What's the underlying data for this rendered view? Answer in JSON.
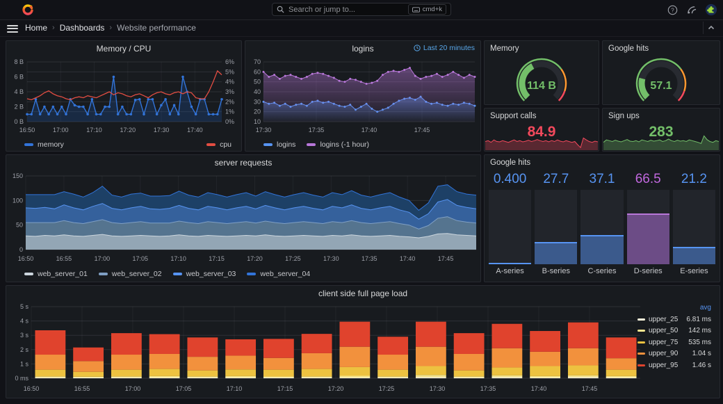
{
  "colors": {
    "page_bg": "#111217",
    "panel_bg": "#181b1f",
    "blue": "#5794F2",
    "dark_blue": "#3274D9",
    "purple": "#B877D9",
    "green": "#73BF69",
    "red": "#F2495C",
    "orange": "#FF9830",
    "time_badge": "#58a6e8",
    "axis_text": "#9da0a8"
  },
  "nav": {
    "search_placeholder": "Search or jump to...",
    "search_shortcut": "cmd+k",
    "icons": [
      "help-icon",
      "news-icon",
      "user-avatar"
    ],
    "breadcrumb": {
      "home": "Home",
      "dashboards": "Dashboards",
      "current": "Website performance"
    }
  },
  "stats": {
    "memory_gauge": {
      "title": "Memory",
      "value": "114 B",
      "percent": 0.4,
      "color": "#73BF69",
      "thresholds": [
        {
          "upto": 0.7,
          "color": "#73BF69"
        },
        {
          "upto": 0.9,
          "color": "#FF9830"
        },
        {
          "upto": 1.0,
          "color": "#F2495C"
        }
      ]
    },
    "google_gauge": {
      "title": "Google hits",
      "value": "57.1",
      "percent": 0.22,
      "color": "#73BF69",
      "thresholds": [
        {
          "upto": 0.7,
          "color": "#73BF69"
        },
        {
          "upto": 0.9,
          "color": "#FF9830"
        },
        {
          "upto": 1.0,
          "color": "#F2495C"
        }
      ]
    },
    "support_calls": {
      "title": "Support calls",
      "value": "84.9",
      "color": "#F2495C",
      "fill": "rgba(242,73,92,0.30)",
      "spark": [
        0.5,
        0.55,
        0.45,
        0.6,
        0.5,
        0.48,
        0.55,
        0.5,
        0.45,
        0.52,
        0.6,
        0.5,
        0.55,
        0.48,
        0.52,
        0.58,
        0.5,
        0.55,
        0.62,
        0.55,
        0.5,
        0.55,
        0.48,
        0.56,
        0.5,
        0.6,
        0.52,
        0.48,
        0.55,
        0.5,
        0.45,
        0.5,
        0.3,
        0.12,
        0.72,
        0.6,
        0.5,
        0.45,
        0.52,
        0.48
      ]
    },
    "sign_ups": {
      "title": "Sign ups",
      "value": "283",
      "color": "#73BF69",
      "fill": "rgba(115,191,105,0.30)",
      "spark": [
        0.45,
        0.6,
        0.55,
        0.5,
        0.58,
        0.52,
        0.48,
        0.55,
        0.62,
        0.52,
        0.5,
        0.55,
        0.48,
        0.6,
        0.55,
        0.5,
        0.58,
        0.52,
        0.55,
        0.6,
        0.5,
        0.55,
        0.65,
        0.55,
        0.5,
        0.58,
        0.52,
        0.55,
        0.5,
        0.6,
        0.55,
        0.5,
        0.45,
        0.38,
        0.85,
        0.62,
        0.5,
        0.45,
        0.55,
        0.5
      ]
    }
  },
  "chart_data": [
    {
      "id": "memory_cpu",
      "type": "line",
      "title": "Memory / CPU",
      "x_ticks": [
        "16:50",
        "17:00",
        "17:10",
        "17:20",
        "17:30",
        "17:40"
      ],
      "x_span_min": 58,
      "x_tick_step_min": 10,
      "y_left": {
        "ticks": [
          "0 B",
          "2 B",
          "4 B",
          "6 B",
          "8 B"
        ],
        "max": 8
      },
      "y_right": {
        "ticks": [
          "0%",
          "1%",
          "2%",
          "3%",
          "4%",
          "5%",
          "6%"
        ],
        "max": 6
      },
      "series": [
        {
          "name": "memory",
          "color": "#3274D9",
          "fill": "rgba(31,96,196,0.22)",
          "axis": "left",
          "points": true,
          "values": [
            1,
            1,
            3,
            1,
            2,
            1,
            2,
            1,
            2,
            1,
            3,
            2.2,
            2,
            2,
            1,
            3,
            1,
            1,
            2,
            2,
            6,
            1,
            2,
            1,
            1,
            2.9,
            3,
            1,
            3,
            3,
            1,
            2.2,
            3,
            1,
            2.2,
            1,
            6,
            4,
            2,
            1,
            3,
            3,
            1,
            1,
            1,
            3
          ]
        },
        {
          "name": "cpu",
          "color": "#E24D42",
          "axis": "right",
          "points": false,
          "values": [
            2.3,
            2.2,
            2.4,
            2.6,
            2.9,
            3.1,
            2.8,
            2.6,
            2.5,
            2.3,
            2.2,
            2.4,
            2.5,
            2.4,
            2.6,
            2.5,
            2.4,
            2.6,
            2.8,
            3.0,
            2.7,
            2.9,
            2.8,
            2.6,
            2.5,
            2.7,
            2.8,
            2.6,
            2.4,
            2.7,
            2.9,
            3.0,
            2.8,
            2.7,
            2.9,
            3.0,
            2.8,
            3.0,
            2.9,
            2.4,
            2.3,
            2.3,
            3.0,
            4.0,
            5.1,
            4.7
          ]
        }
      ]
    },
    {
      "id": "logins",
      "type": "line",
      "title": "logins",
      "time_range": "Last 20 minutes",
      "x_ticks": [
        "17:30",
        "17:35",
        "17:40",
        "17:45"
      ],
      "x_span_min": 20,
      "x_tick_step_min": 5,
      "ylim": [
        10,
        70
      ],
      "y_ticks": [
        "10",
        "20",
        "30",
        "40",
        "50",
        "60",
        "70"
      ],
      "series": [
        {
          "name": "logins",
          "color": "#5794F2",
          "values": [
            30,
            28,
            29,
            26,
            28,
            25,
            27,
            28,
            26,
            30,
            31,
            29,
            30,
            28,
            26,
            25,
            27,
            22,
            25,
            28,
            23,
            20,
            22,
            24,
            28,
            31,
            33,
            34,
            32,
            35,
            30,
            28,
            29,
            27,
            26,
            28,
            27,
            29,
            28,
            26
          ]
        },
        {
          "name": "logins (-1 hour)",
          "color": "#B877D9",
          "values": [
            60,
            55,
            57,
            53,
            56,
            57,
            55,
            53,
            55,
            58,
            59,
            58,
            56,
            54,
            51,
            50,
            53,
            52,
            50,
            48,
            49,
            51,
            57,
            60,
            61,
            60,
            62,
            64,
            56,
            53,
            55,
            56,
            58,
            55,
            57,
            60,
            57,
            54,
            57,
            55
          ]
        }
      ]
    },
    {
      "id": "server_requests",
      "type": "area",
      "stacked": true,
      "title": "server requests",
      "x_ticks": [
        "16:50",
        "16:55",
        "17:00",
        "17:05",
        "17:10",
        "17:15",
        "17:20",
        "17:25",
        "17:30",
        "17:35",
        "17:40",
        "17:45"
      ],
      "x_span_min": 59,
      "x_tick_step_min": 5,
      "ylim": [
        0,
        150
      ],
      "y_ticks": [
        "0",
        "50",
        "100",
        "150"
      ],
      "series": [
        {
          "name": "web_server_01",
          "color": "#CCD6DE",
          "fill": "#93a6b5",
          "values": [
            28,
            27,
            29,
            28,
            30,
            28,
            27,
            29,
            31,
            28,
            27,
            28,
            29,
            28,
            27,
            28,
            30,
            28,
            27,
            29,
            28,
            27,
            28,
            29,
            28,
            30,
            28,
            27,
            28,
            29,
            28,
            27,
            29,
            28,
            30,
            28,
            27,
            28,
            29,
            27,
            26,
            24,
            27,
            32,
            33,
            30,
            29,
            28
          ]
        },
        {
          "name": "web_server_02",
          "color": "#7f9fc4",
          "fill": "#55748f",
          "values": [
            27,
            28,
            26,
            27,
            29,
            27,
            26,
            28,
            30,
            27,
            26,
            27,
            28,
            26,
            27,
            26,
            28,
            27,
            26,
            28,
            27,
            26,
            27,
            28,
            26,
            28,
            27,
            26,
            27,
            28,
            27,
            26,
            28,
            27,
            29,
            27,
            26,
            27,
            28,
            26,
            24,
            18,
            22,
            32,
            34,
            29,
            27,
            26
          ]
        },
        {
          "name": "web_server_03",
          "color": "#5794F2",
          "fill": "#35619c",
          "values": [
            30,
            29,
            31,
            28,
            32,
            30,
            28,
            31,
            33,
            29,
            28,
            30,
            31,
            29,
            28,
            30,
            32,
            29,
            28,
            31,
            30,
            28,
            30,
            31,
            29,
            32,
            30,
            28,
            30,
            31,
            29,
            28,
            31,
            30,
            32,
            29,
            28,
            30,
            31,
            28,
            26,
            20,
            24,
            33,
            35,
            31,
            30,
            29
          ]
        },
        {
          "name": "web_server_04",
          "color": "#3274D9",
          "fill": "#1d4066",
          "values": [
            27,
            28,
            26,
            29,
            27,
            28,
            26,
            28,
            35,
            27,
            26,
            28,
            27,
            26,
            27,
            26,
            29,
            27,
            26,
            28,
            27,
            26,
            27,
            28,
            26,
            28,
            27,
            26,
            27,
            28,
            27,
            26,
            28,
            27,
            29,
            27,
            26,
            27,
            28,
            26,
            24,
            18,
            22,
            32,
            30,
            28,
            27,
            28
          ]
        }
      ]
    },
    {
      "id": "google_hits_bars",
      "type": "bar",
      "title": "Google hits",
      "max": 100,
      "bars": [
        {
          "label": "A-series",
          "display": "0.400",
          "value": 0.4,
          "value_color": "#5794F2",
          "fill": "#3B5A8C",
          "top": "#5794F2"
        },
        {
          "label": "B-series",
          "display": "27.7",
          "value": 27.7,
          "value_color": "#5794F2",
          "fill": "#3B5A8C",
          "top": "#5794F2"
        },
        {
          "label": "C-series",
          "display": "37.1",
          "value": 37.1,
          "value_color": "#5794F2",
          "fill": "#3B5A8C",
          "top": "#5794F2"
        },
        {
          "label": "D-series",
          "display": "66.5",
          "value": 66.5,
          "value_color": "#C168DE",
          "fill": "#6C4C86",
          "top": "#B877D9"
        },
        {
          "label": "E-series",
          "display": "21.2",
          "value": 21.2,
          "value_color": "#5794F2",
          "fill": "#3B5A8C",
          "top": "#5794F2"
        }
      ]
    },
    {
      "id": "client_load",
      "type": "bar",
      "stacked": true,
      "title": "client side full page load",
      "x_ticks": [
        "16:50",
        "16:55",
        "17:00",
        "17:05",
        "17:10",
        "17:15",
        "17:20",
        "17:25",
        "17:30",
        "17:35",
        "17:40",
        "17:45"
      ],
      "x_span_min": 60,
      "x_tick_step_min": 5,
      "ylim": [
        0,
        5
      ],
      "y_ticks": [
        "0 ms",
        "1 s",
        "2 s",
        "3 s",
        "4 s",
        "5 s"
      ],
      "legend_header": "avg",
      "series_meta": [
        {
          "name": "upper_25",
          "color": "#FCF7DC",
          "avg": "6.81 ms"
        },
        {
          "name": "upper_50",
          "color": "#F6E690",
          "avg": "142 ms"
        },
        {
          "name": "upper_75",
          "color": "#EDC240",
          "avg": "535 ms"
        },
        {
          "name": "upper_90",
          "color": "#F2913D",
          "avg": "1.04 s"
        },
        {
          "name": "upper_95",
          "color": "#E0432D",
          "avg": "1.46 s"
        }
      ],
      "bars": [
        [
          0.05,
          0.08,
          0.47,
          1.05,
          1.7
        ],
        [
          0.05,
          0.06,
          0.34,
          0.75,
          0.95
        ],
        [
          0.05,
          0.08,
          0.47,
          1.05,
          1.5
        ],
        [
          0.05,
          0.1,
          0.5,
          1.05,
          1.38
        ],
        [
          0.05,
          0.08,
          0.42,
          0.95,
          1.35
        ],
        [
          0.05,
          0.1,
          0.47,
          0.96,
          1.14
        ],
        [
          0.05,
          0.07,
          0.48,
          0.82,
          1.33
        ],
        [
          0.05,
          0.08,
          0.52,
          1.1,
          1.35
        ],
        [
          0.05,
          0.12,
          0.61,
          1.42,
          1.75
        ],
        [
          0.05,
          0.08,
          0.47,
          1.05,
          1.25
        ],
        [
          0.08,
          0.15,
          0.62,
          1.35,
          1.75
        ],
        [
          0.05,
          0.08,
          0.42,
          1.15,
          1.45
        ],
        [
          0.08,
          0.12,
          0.55,
          1.35,
          1.7
        ],
        [
          0.05,
          0.1,
          0.7,
          1.0,
          1.45
        ],
        [
          0.08,
          0.12,
          0.7,
          1.2,
          1.8
        ],
        [
          0.05,
          0.1,
          0.45,
          0.8,
          1.45
        ]
      ]
    }
  ]
}
